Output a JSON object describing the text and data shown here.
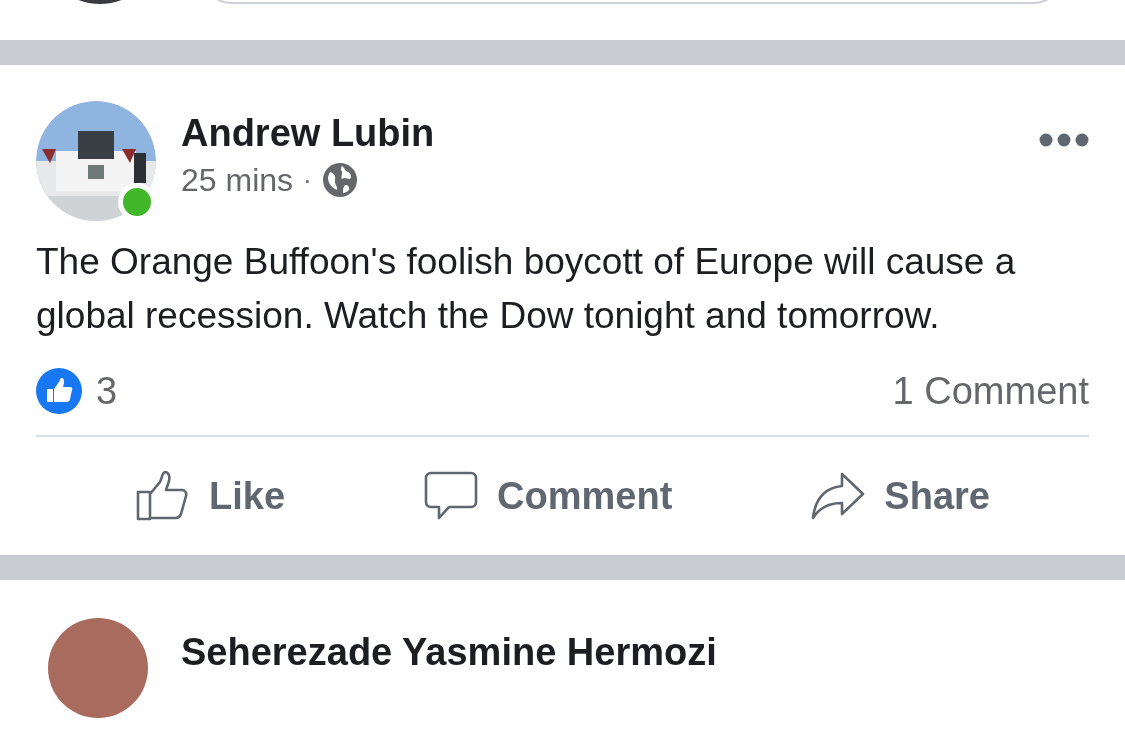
{
  "post": {
    "author": "Andrew Lubin",
    "online": true,
    "time": "25 mins",
    "separator": "·",
    "text": "The Orange Buffoon's foolish boycott of Europe will cause a global recession. Watch the Dow tonight and tomorrow.",
    "reactions": "3",
    "comments": "1 Comment",
    "actions": [
      {
        "kind": "like",
        "label": "Like"
      },
      {
        "kind": "comment",
        "label": "Comment"
      },
      {
        "kind": "share",
        "label": "Share"
      }
    ]
  },
  "next_post": {
    "author": "Seherezade Yasmine Hermozi"
  }
}
